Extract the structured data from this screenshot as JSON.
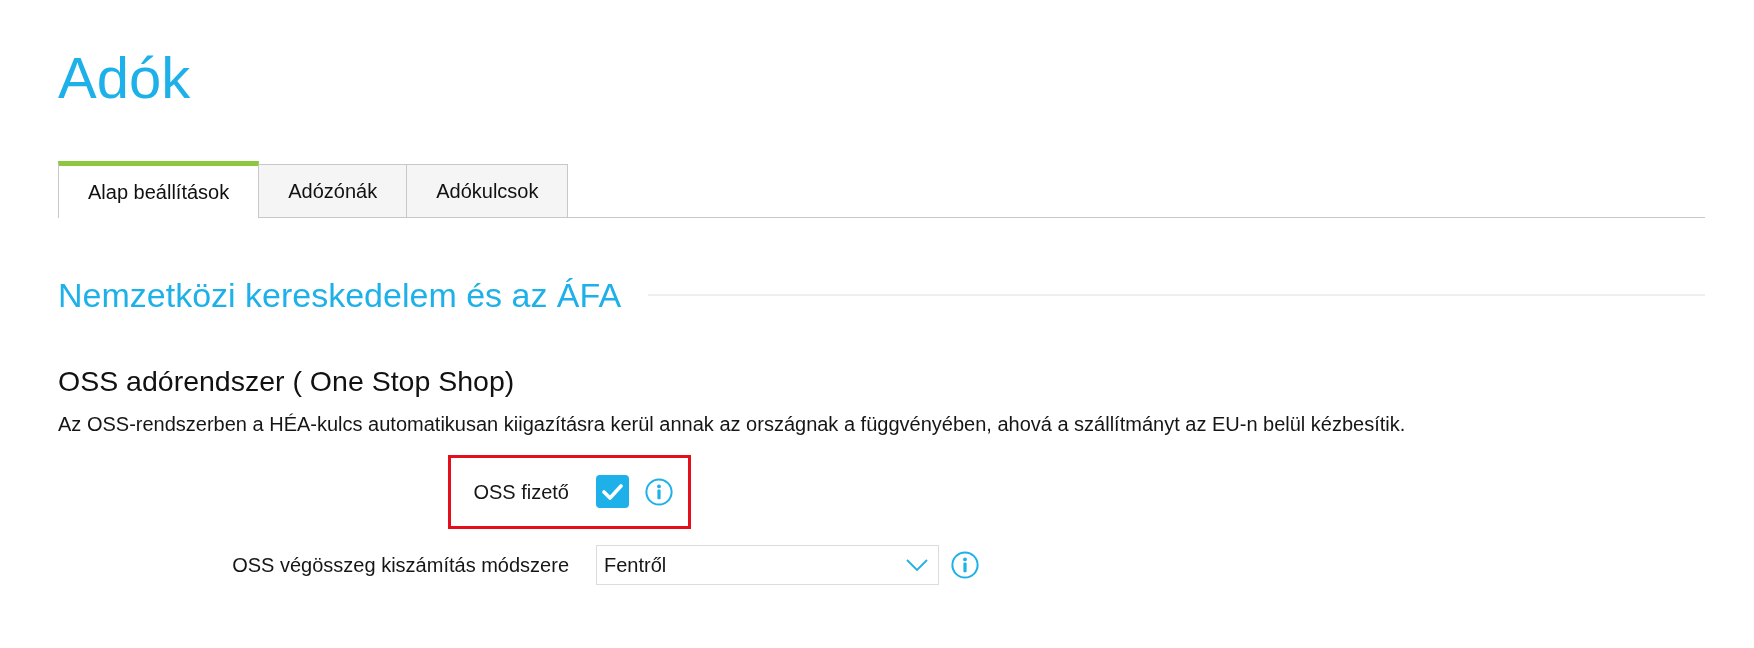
{
  "page": {
    "title": "Adók"
  },
  "tabs": [
    {
      "label": "Alap beállítások",
      "selected": true
    },
    {
      "label": "Adózónák",
      "selected": false
    },
    {
      "label": "Adókulcsok",
      "selected": false
    }
  ],
  "section": {
    "title": "Nemzetközi kereskedelem és az ÁFA"
  },
  "subsection": {
    "title": "OSS adórendszer ( One Stop Shop)",
    "description": "Az OSS-rendszerben a HÉA-kulcs automatikusan kiigazításra kerül annak az országnak a függvényében, ahová a szállítmányt az EU-n belül kézbesítik."
  },
  "fields": [
    {
      "kind": "checkbox",
      "label": "OSS fizető",
      "checked": true,
      "highlighted": true
    },
    {
      "kind": "select",
      "label": "OSS végösszeg kiszámítás módszere",
      "value": "Fentről",
      "highlighted": false
    }
  ]
}
